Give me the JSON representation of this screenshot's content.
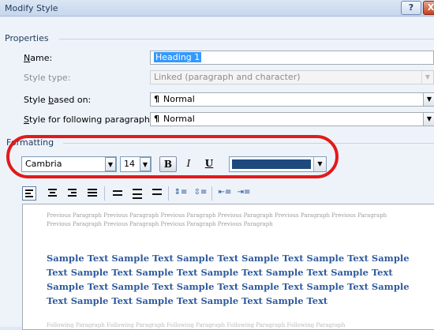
{
  "window": {
    "title": "Modify Style",
    "help_label": "?",
    "close_label": "X"
  },
  "properties": {
    "section_label": "Properties",
    "name": {
      "label_pre": "",
      "label_u": "N",
      "label_post": "ame:",
      "value": "Heading 1"
    },
    "style_type": {
      "label": "Style type:",
      "value": "Linked (paragraph and character)"
    },
    "based_on": {
      "label_pre": "Style ",
      "label_u": "b",
      "label_post": "ased on:",
      "icon": "¶",
      "value": "Normal"
    },
    "following": {
      "label_pre": "",
      "label_u": "S",
      "label_post": "tyle for following paragraph:",
      "icon": "¶",
      "value": "Normal"
    }
  },
  "formatting": {
    "section_label": "Formatting",
    "font": "Cambria",
    "size": "14",
    "bold_label": "B",
    "italic_label": "I",
    "underline_label": "U",
    "font_color": "#1f497d"
  },
  "alignment": {
    "buttons": [
      "align-left",
      "align-center",
      "align-right",
      "justify",
      "spacing-single",
      "spacing-onehalf",
      "spacing-double",
      "space-before-increase",
      "space-before-decrease",
      "indent-decrease",
      "indent-increase"
    ]
  },
  "preview": {
    "previous_paragraph": "Previous Paragraph Previous Paragraph Previous Paragraph Previous Paragraph Previous Paragraph Previous Paragraph Previous Paragraph Previous Paragraph Previous Paragraph Previous Paragraph",
    "sample_text": "Sample Text Sample Text Sample Text Sample Text Sample Text Sample Text Sample Text Sample Text Sample Text Sample Text Sample Text Sample Text Sample Text Sample Text Sample Text Sample Text Sample Text Sample Text Sample Text Sample Text Sample Text",
    "following_paragraph": "Following Paragraph Following Paragraph Following Paragraph Following Paragraph Following Paragraph"
  },
  "colors": {
    "highlight": "#e21a1a",
    "sample_text": "#2e5a9c"
  }
}
